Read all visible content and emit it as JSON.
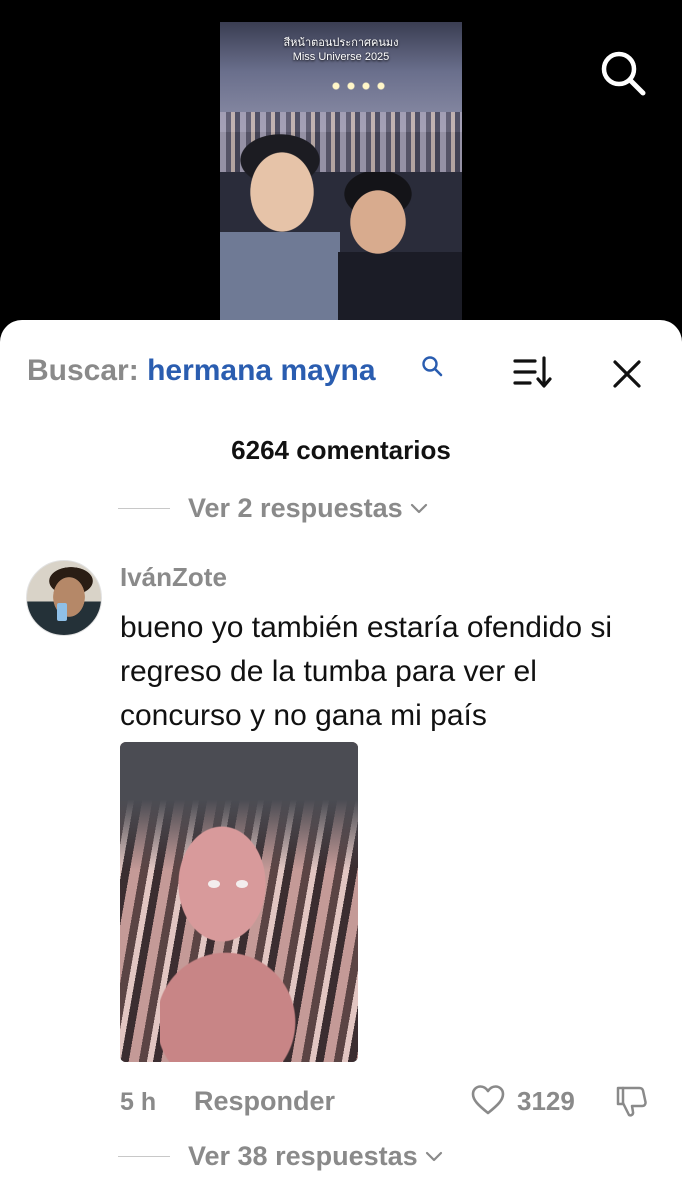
{
  "video": {
    "caption_line1": "สีหน้าตอนประกาศคนมง",
    "caption_line2": "Miss Universe 2025"
  },
  "header": {
    "search_prefix": "Buscar:",
    "search_query": "hermana mayna"
  },
  "comments_count": "6264 comentarios",
  "replies_top": {
    "label": "Ver 2 respuestas"
  },
  "comment": {
    "username": "IvánZote",
    "text": "bueno yo también estaría ofendido si regreso de la tumba para ver el concurso y no gana mi país",
    "time": "5 h",
    "reply_label": "Responder",
    "likes": "3129"
  },
  "replies_bottom": {
    "label": "Ver 38 respuestas"
  },
  "icons": {
    "top_search": "search-icon",
    "query": "search-icon",
    "sort": "sort-icon",
    "close": "close-icon",
    "like": "heart-icon",
    "dislike": "thumbs-down-icon",
    "expand": "chevron-down-icon"
  },
  "colors": {
    "query_blue": "#2a5db0",
    "muted": "#8a8a8a",
    "text": "#111111",
    "sheet_bg": "#ffffff",
    "video_bg": "#000000"
  }
}
